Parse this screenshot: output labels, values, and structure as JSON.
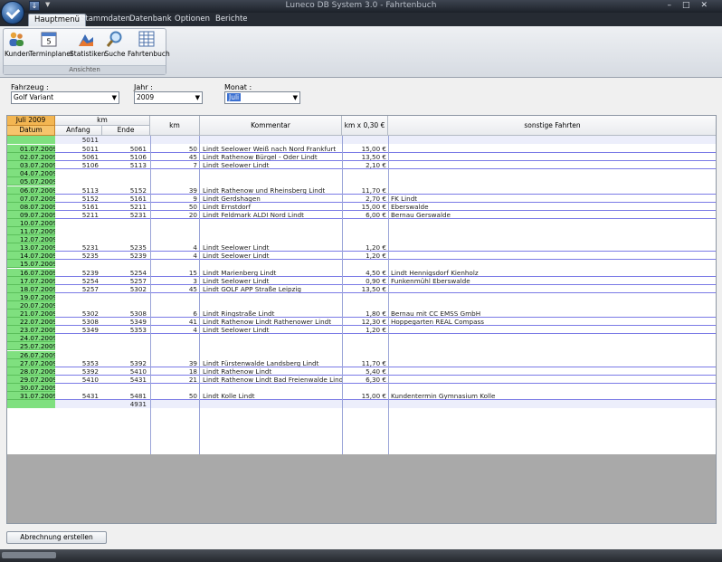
{
  "window": {
    "title": "Luneco DB System 3.0 - Fahrtenbuch",
    "quick_access_icon": "save-icon",
    "controls": [
      "–",
      "□",
      "✕"
    ]
  },
  "ribbon": {
    "tabs": [
      {
        "label": "Hauptmenü",
        "active": true
      },
      {
        "label": "Stammdaten",
        "active": false
      },
      {
        "label": "Datenbank",
        "active": false
      },
      {
        "label": "Optionen",
        "active": false
      },
      {
        "label": "Berichte",
        "active": false
      }
    ],
    "group_label": "Ansichten",
    "buttons": [
      {
        "label": "Kunden",
        "icon": "people-icon"
      },
      {
        "label": "Terminplaner",
        "icon": "calendar-icon"
      },
      {
        "label": "Statistiken",
        "icon": "chart-icon"
      },
      {
        "label": "Suche",
        "icon": "magnifier-icon"
      },
      {
        "label": "Fahrtenbuch",
        "icon": "table-icon"
      }
    ]
  },
  "filters": {
    "fahrzeug_label": "Fahrzeug :",
    "fahrzeug_value": "Golf Variant",
    "jahr_label": "Jahr :",
    "jahr_value": "2009",
    "monat_label": "Monat :",
    "monat_value": "Juli"
  },
  "grid": {
    "month_header": "Juli 2009",
    "datum_header": "Datum",
    "km_group_header": "km",
    "anfang_header": "Anfang",
    "ende_header": "Ende",
    "km_header": "km",
    "kommentar_header": "Kommentar",
    "geld_header": "km x 0,30 €",
    "sonstige_header": "sonstige Fahrten",
    "start_value": "5011",
    "total_value": "4931",
    "rows": [
      {
        "date": "01.07.2009",
        "anfang": "5011",
        "ende": "5061",
        "km": "50",
        "kommentar": "Lindt Seelower Weiß nach Nord Frankfurt",
        "geld": "15,00 €",
        "sonst": ""
      },
      {
        "date": "02.07.2009",
        "anfang": "5061",
        "ende": "5106",
        "km": "45",
        "kommentar": "Lindt Rathenow Bürgel - Oder Lindt",
        "geld": "13,50 €",
        "sonst": ""
      },
      {
        "date": "03.07.2009",
        "anfang": "5106",
        "ende": "5113",
        "km": "7",
        "kommentar": "Lindt Seelower Lindt",
        "geld": "2,10 €",
        "sonst": ""
      },
      {
        "date": "04.07.2009",
        "anfang": "",
        "ende": "",
        "km": "",
        "kommentar": "",
        "geld": "",
        "sonst": ""
      },
      {
        "date": "05.07.2009",
        "anfang": "",
        "ende": "",
        "km": "",
        "kommentar": "",
        "geld": "",
        "sonst": ""
      },
      {
        "date": "06.07.2009",
        "anfang": "5113",
        "ende": "5152",
        "km": "39",
        "kommentar": "Lindt Rathenow und Rheinsberg Lindt",
        "geld": "11,70 €",
        "sonst": ""
      },
      {
        "date": "07.07.2009",
        "anfang": "5152",
        "ende": "5161",
        "km": "9",
        "kommentar": "Lindt Gerdshagen",
        "geld": "2,70 €",
        "sonst": "FK Lindt"
      },
      {
        "date": "08.07.2009",
        "anfang": "5161",
        "ende": "5211",
        "km": "50",
        "kommentar": "Lindt Ernstdorf",
        "geld": "15,00 €",
        "sonst": "Eberswalde"
      },
      {
        "date": "09.07.2009",
        "anfang": "5211",
        "ende": "5231",
        "km": "20",
        "kommentar": "Lindt Feldmark ALDI Nord Lindt",
        "geld": "6,00 €",
        "sonst": "Bernau Gerswalde"
      },
      {
        "date": "10.07.2009",
        "anfang": "",
        "ende": "",
        "km": "",
        "kommentar": "",
        "geld": "",
        "sonst": ""
      },
      {
        "date": "11.07.2009",
        "anfang": "",
        "ende": "",
        "km": "",
        "kommentar": "",
        "geld": "",
        "sonst": ""
      },
      {
        "date": "12.07.2009",
        "anfang": "",
        "ende": "",
        "km": "",
        "kommentar": "",
        "geld": "",
        "sonst": ""
      },
      {
        "date": "13.07.2009",
        "anfang": "5231",
        "ende": "5235",
        "km": "4",
        "kommentar": "Lindt Seelower Lindt",
        "geld": "1,20 €",
        "sonst": ""
      },
      {
        "date": "14.07.2009",
        "anfang": "5235",
        "ende": "5239",
        "km": "4",
        "kommentar": "Lindt Seelower Lindt",
        "geld": "1,20 €",
        "sonst": ""
      },
      {
        "date": "15.07.2009",
        "anfang": "",
        "ende": "",
        "km": "",
        "kommentar": "",
        "geld": "",
        "sonst": ""
      },
      {
        "date": "16.07.2009",
        "anfang": "5239",
        "ende": "5254",
        "km": "15",
        "kommentar": "Lindt Marienberg Lindt",
        "geld": "4,50 €",
        "sonst": "Lindt Hennigsdorf Kienholz"
      },
      {
        "date": "17.07.2009",
        "anfang": "5254",
        "ende": "5257",
        "km": "3",
        "kommentar": "Lindt Seelower Lindt",
        "geld": "0,90 €",
        "sonst": "Funkenmühl Eberswalde"
      },
      {
        "date": "18.07.2009",
        "anfang": "5257",
        "ende": "5302",
        "km": "45",
        "kommentar": "Lindt GOLF APP Straße Leipzig",
        "geld": "13,50 €",
        "sonst": ""
      },
      {
        "date": "19.07.2009",
        "anfang": "",
        "ende": "",
        "km": "",
        "kommentar": "",
        "geld": "",
        "sonst": ""
      },
      {
        "date": "20.07.2009",
        "anfang": "",
        "ende": "",
        "km": "",
        "kommentar": "",
        "geld": "",
        "sonst": ""
      },
      {
        "date": "21.07.2009",
        "anfang": "5302",
        "ende": "5308",
        "km": "6",
        "kommentar": "Lindt Ringstraße Lindt",
        "geld": "1,80 €",
        "sonst": "Bernau mit CC EMSS GmbH"
      },
      {
        "date": "22.07.2009",
        "anfang": "5308",
        "ende": "5349",
        "km": "41",
        "kommentar": "Lindt Rathenow Lindt Rathenower Lindt",
        "geld": "12,30 €",
        "sonst": "Hoppegarten REAL Compass"
      },
      {
        "date": "23.07.2009",
        "anfang": "5349",
        "ende": "5353",
        "km": "4",
        "kommentar": "Lindt Seelower Lindt",
        "geld": "1,20 €",
        "sonst": ""
      },
      {
        "date": "24.07.2009",
        "anfang": "",
        "ende": "",
        "km": "",
        "kommentar": "",
        "geld": "",
        "sonst": ""
      },
      {
        "date": "25.07.2009",
        "anfang": "",
        "ende": "",
        "km": "",
        "kommentar": "",
        "geld": "",
        "sonst": ""
      },
      {
        "date": "26.07.2009",
        "anfang": "",
        "ende": "",
        "km": "",
        "kommentar": "",
        "geld": "",
        "sonst": ""
      },
      {
        "date": "27.07.2009",
        "anfang": "5353",
        "ende": "5392",
        "km": "39",
        "kommentar": "Lindt Fürstenwalde Landsberg Lindt",
        "geld": "11,70 €",
        "sonst": ""
      },
      {
        "date": "28.07.2009",
        "anfang": "5392",
        "ende": "5410",
        "km": "18",
        "kommentar": "Lindt Rathenow Lindt",
        "geld": "5,40 €",
        "sonst": ""
      },
      {
        "date": "29.07.2009",
        "anfang": "5410",
        "ende": "5431",
        "km": "21",
        "kommentar": "Lindt Rathenow Lindt Bad Freienwalde Lindt",
        "geld": "6,30 €",
        "sonst": ""
      },
      {
        "date": "30.07.2009",
        "anfang": "",
        "ende": "",
        "km": "",
        "kommentar": "",
        "geld": "",
        "sonst": ""
      },
      {
        "date": "31.07.2009",
        "anfang": "5431",
        "ende": "5481",
        "km": "50",
        "kommentar": "Lindt Kolle Lindt",
        "geld": "15,00 €",
        "sonst": "Kundentermin Gymnasium Kolle"
      }
    ]
  },
  "footer": {
    "abrechnung_label": "Abrechnung erstellen"
  }
}
